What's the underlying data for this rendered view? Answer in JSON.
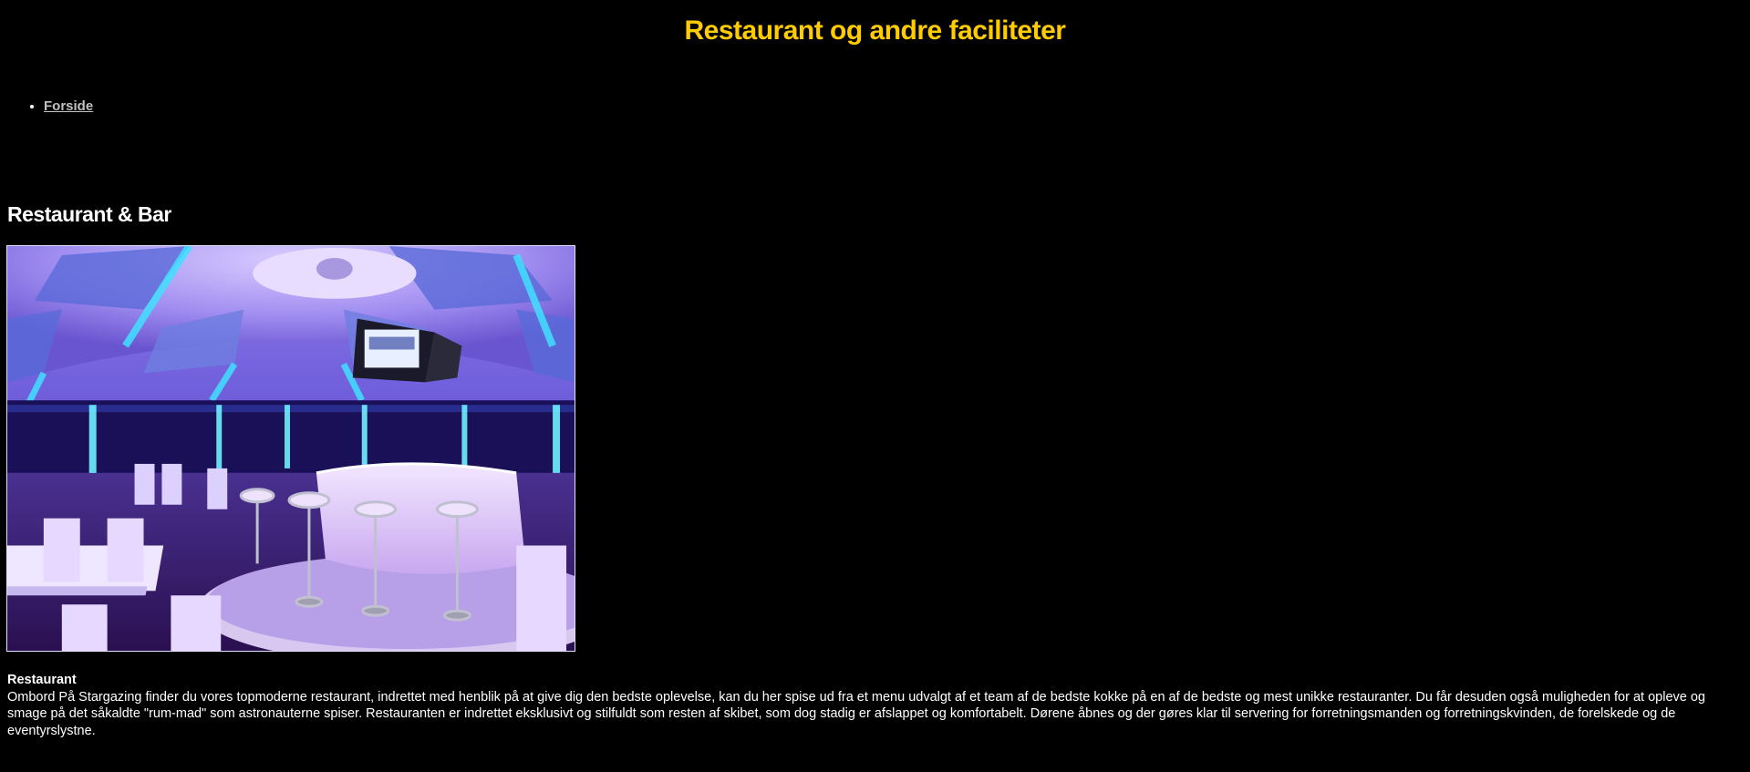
{
  "header": {
    "title": "Restaurant og andre faciliteter"
  },
  "nav": {
    "items": [
      {
        "label": "Forside"
      }
    ]
  },
  "main": {
    "section_heading": "Restaurant & Bar",
    "image_alt": "Restaurant interior with blue and purple lighting",
    "subheading": "Restaurant",
    "paragraph": "Ombord På Stargazing finder du vores topmoderne restaurant, indrettet med henblik på at give dig den bedste oplevelse, kan du her spise ud fra et menu udvalgt af et team af de bedste kokke på en af de bedste og mest unikke restauranter. Du får desuden også muligheden for at opleve og smage på det såkaldte \"rum-mad\" som astronauterne spiser. Restauranten er indrettet eksklusivt og stilfuldt som resten af skibet, som dog stadig er afslappet og komfortabelt. Dørene åbnes og der gøres klar til servering for forretningsmanden og forretningskvinden, de forelskede og de eventyrslystne."
  },
  "colors": {
    "background": "#000000",
    "title": "#ffcc00",
    "text": "#ffffff",
    "link": "#c0c0c0"
  }
}
